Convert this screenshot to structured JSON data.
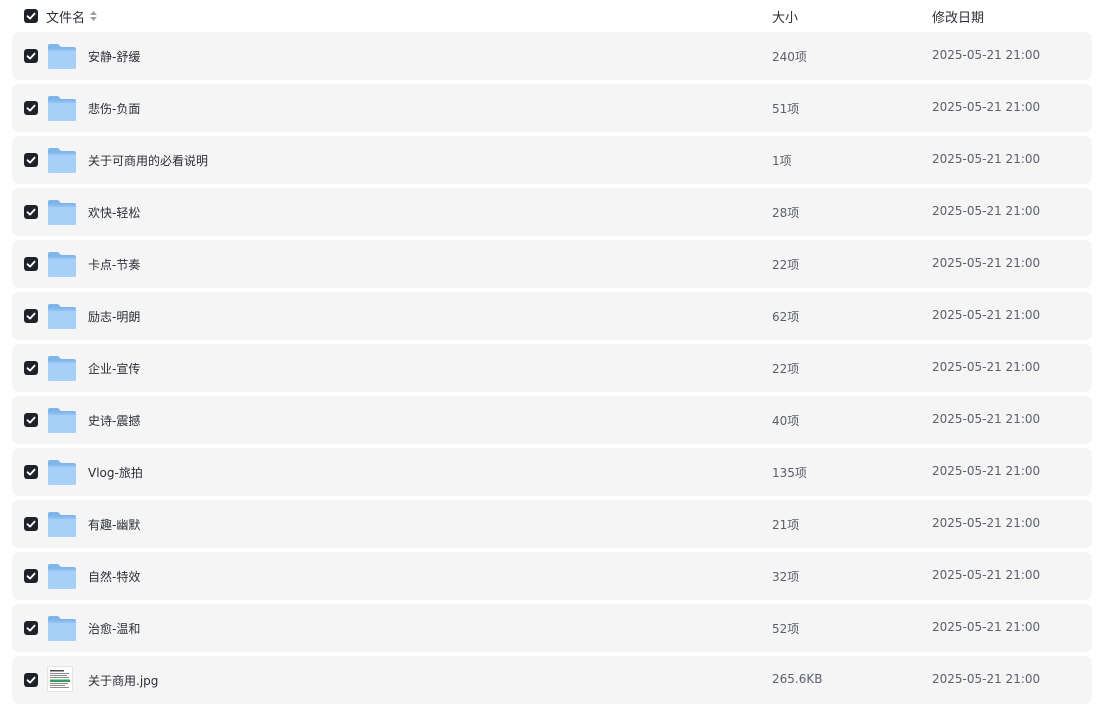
{
  "header": {
    "name_label": "文件名",
    "size_label": "大小",
    "date_label": "修改日期",
    "select_all_checked": true
  },
  "colors": {
    "checkbox": "#1f2329",
    "row_background": "#f5f5f6",
    "folder_back": "#7fb6ea",
    "folder_front": "#a6d0f7"
  },
  "files": [
    {
      "name": "安静-舒缓",
      "size": "240项",
      "modified": "2025-05-21 21:00",
      "type": "folder",
      "icon": "folder-icon",
      "checked": true
    },
    {
      "name": "悲伤-负面",
      "size": "51项",
      "modified": "2025-05-21 21:00",
      "type": "folder",
      "icon": "folder-icon",
      "checked": true
    },
    {
      "name": "关于可商用的必看说明",
      "size": "1项",
      "modified": "2025-05-21 21:00",
      "type": "folder",
      "icon": "folder-icon",
      "checked": true
    },
    {
      "name": "欢快-轻松",
      "size": "28项",
      "modified": "2025-05-21 21:00",
      "type": "folder",
      "icon": "folder-icon",
      "checked": true
    },
    {
      "name": "卡点-节奏",
      "size": "22项",
      "modified": "2025-05-21 21:00",
      "type": "folder",
      "icon": "folder-icon",
      "checked": true
    },
    {
      "name": "励志-明朗",
      "size": "62项",
      "modified": "2025-05-21 21:00",
      "type": "folder",
      "icon": "folder-icon",
      "checked": true
    },
    {
      "name": "企业-宣传",
      "size": "22项",
      "modified": "2025-05-21 21:00",
      "type": "folder",
      "icon": "folder-icon",
      "checked": true
    },
    {
      "name": "史诗-震撼",
      "size": "40项",
      "modified": "2025-05-21 21:00",
      "type": "folder",
      "icon": "folder-icon",
      "checked": true
    },
    {
      "name": "Vlog-旅拍",
      "size": "135项",
      "modified": "2025-05-21 21:00",
      "type": "folder",
      "icon": "folder-icon",
      "checked": true
    },
    {
      "name": "有趣-幽默",
      "size": "21项",
      "modified": "2025-05-21 21:00",
      "type": "folder",
      "icon": "folder-icon",
      "checked": true
    },
    {
      "name": "自然-特效",
      "size": "32项",
      "modified": "2025-05-21 21:00",
      "type": "folder",
      "icon": "folder-icon",
      "checked": true
    },
    {
      "name": "治愈-温和",
      "size": "52项",
      "modified": "2025-05-21 21:00",
      "type": "folder",
      "icon": "folder-icon",
      "checked": true
    },
    {
      "name": "关于商用.jpg",
      "size": "265.6KB",
      "modified": "2025-05-21 21:00",
      "type": "image",
      "icon": "image-thumbnail-icon",
      "checked": true
    }
  ]
}
